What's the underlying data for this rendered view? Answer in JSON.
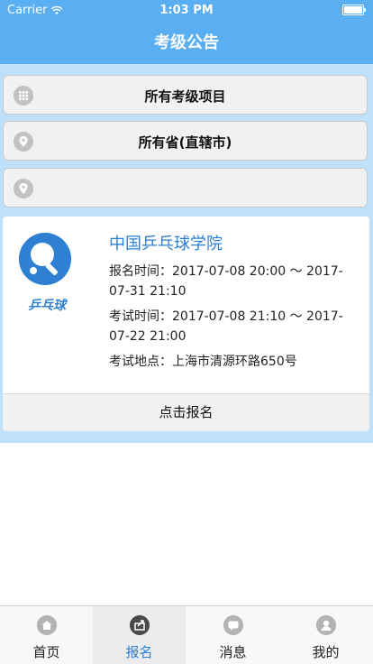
{
  "status_bar": {
    "carrier": "Carrier",
    "time": "1:03 PM"
  },
  "nav": {
    "title": "考级公告"
  },
  "filters": [
    {
      "label": "所有考级项目",
      "icon": "grid-icon"
    },
    {
      "label": "所有省(直辖市)",
      "icon": "location-pin-icon"
    },
    {
      "label": "",
      "icon": "location-pin-icon"
    }
  ],
  "card": {
    "logo_text": "乒乓球",
    "title": "中国乒乓球学院",
    "signup_time": "报名时间：2017-07-08 20:00 ～ 2017-07-31 21:10",
    "exam_time": "考试时间：2017-07-08 21:10 ～ 2017-07-22 21:00",
    "exam_place": "考试地点：上海市清源环路650号",
    "action_label": "点击报名"
  },
  "tabbar": {
    "tabs": [
      {
        "label": "首页",
        "icon": "home-icon",
        "active": false
      },
      {
        "label": "报名",
        "icon": "share-icon",
        "active": true
      },
      {
        "label": "消息",
        "icon": "message-icon",
        "active": false
      },
      {
        "label": "我的",
        "icon": "user-icon",
        "active": false
      }
    ]
  },
  "colors": {
    "primary": "#5aaef2",
    "accent": "#2a7fd6",
    "background_list": "#bfe0fa"
  }
}
